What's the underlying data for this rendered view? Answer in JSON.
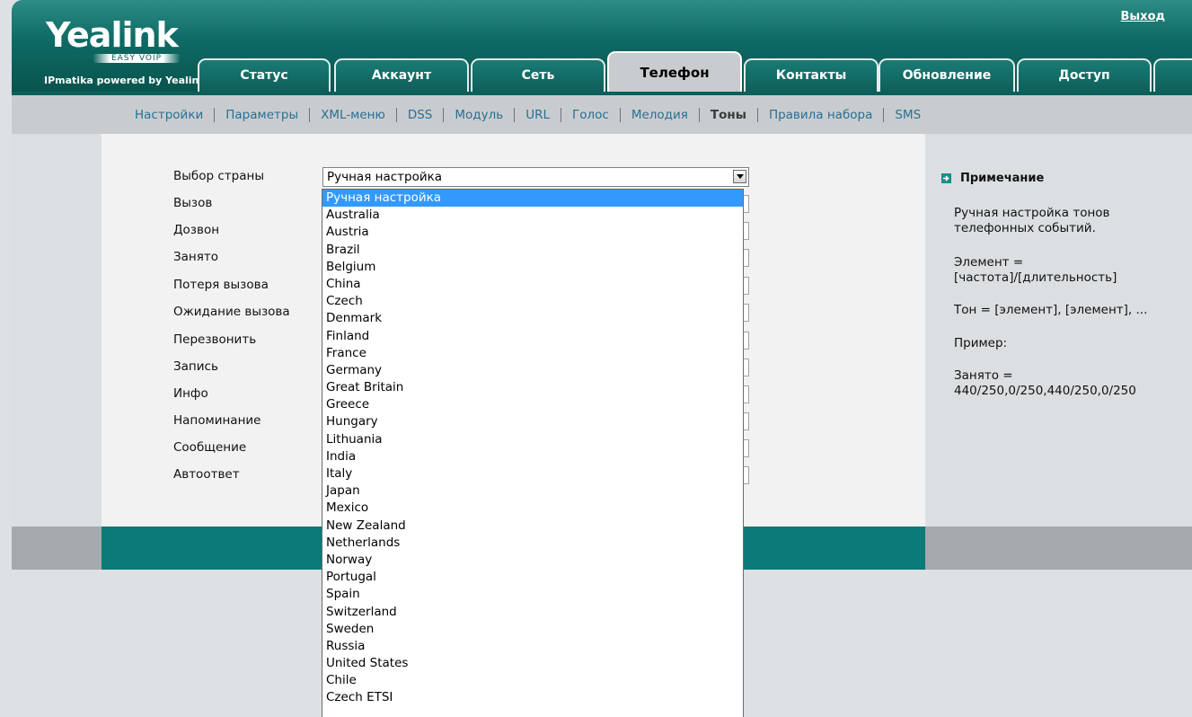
{
  "header": {
    "logo_word": "Yealink",
    "logo_tag": "EASY VOIP",
    "logo_sub": "IPmatika powered by Yealink",
    "logout": "Выход"
  },
  "tabs": [
    {
      "label": "Статус"
    },
    {
      "label": "Аккаунт"
    },
    {
      "label": "Сеть"
    },
    {
      "label": "Телефон",
      "active": true
    },
    {
      "label": "Контакты"
    },
    {
      "label": "Обновление"
    },
    {
      "label": "Доступ"
    }
  ],
  "subnav": [
    {
      "label": "Настройки"
    },
    {
      "label": "Параметры"
    },
    {
      "label": "XML-меню"
    },
    {
      "label": "DSS"
    },
    {
      "label": "Модуль"
    },
    {
      "label": "URL"
    },
    {
      "label": "Голос"
    },
    {
      "label": "Мелодия"
    },
    {
      "label": "Тоны",
      "current": true
    },
    {
      "label": "Правила набора"
    },
    {
      "label": "SMS"
    }
  ],
  "form": {
    "country_label": "Выбор страны",
    "country_value": "Ручная настройка",
    "rows": [
      {
        "label": "Вызов",
        "value": ""
      },
      {
        "label": "Дозвон",
        "value": ""
      },
      {
        "label": "Занято",
        "value": ""
      },
      {
        "label": "Потеря вызова",
        "value": ""
      },
      {
        "label": "Ожидание вызова",
        "value": ""
      },
      {
        "label": "Перезвонить",
        "value": ""
      },
      {
        "label": "Запись",
        "value": ""
      },
      {
        "label": "Инфо",
        "value": ""
      },
      {
        "label": "Напоминание",
        "value": ""
      },
      {
        "label": "Сообщение",
        "value": ""
      },
      {
        "label": "Автоответ",
        "value": ""
      }
    ]
  },
  "dropdown": {
    "options": [
      "Ручная настройка",
      "Australia",
      "Austria",
      "Brazil",
      "Belgium",
      "China",
      "Czech",
      "Denmark",
      "Finland",
      "France",
      "Germany",
      "Great Britain",
      "Greece",
      "Hungary",
      "Lithuania",
      "India",
      "Italy",
      "Japan",
      "Mexico",
      "New Zealand",
      "Netherlands",
      "Norway",
      "Portugal",
      "Spain",
      "Switzerland",
      "Sweden",
      "Russia",
      "United States",
      "Chile",
      "Czech ETSI"
    ],
    "selected_index": 0
  },
  "note": {
    "title": "Примечание",
    "lines": [
      "Ручная настройка тонов телефонных событий.",
      "Элемент = [частота]/[длительность]",
      "Тон = [элемент], [элемент], ...",
      "Пример:",
      "Занято = 440/250,0/250,440/250,0/250"
    ]
  },
  "colors": {
    "header_teal": "#0f6b65",
    "subnav_gray": "#c9ccce",
    "footer_teal": "#0c7a76",
    "link_blue": "#296f96",
    "selection_blue": "#3399ff"
  }
}
